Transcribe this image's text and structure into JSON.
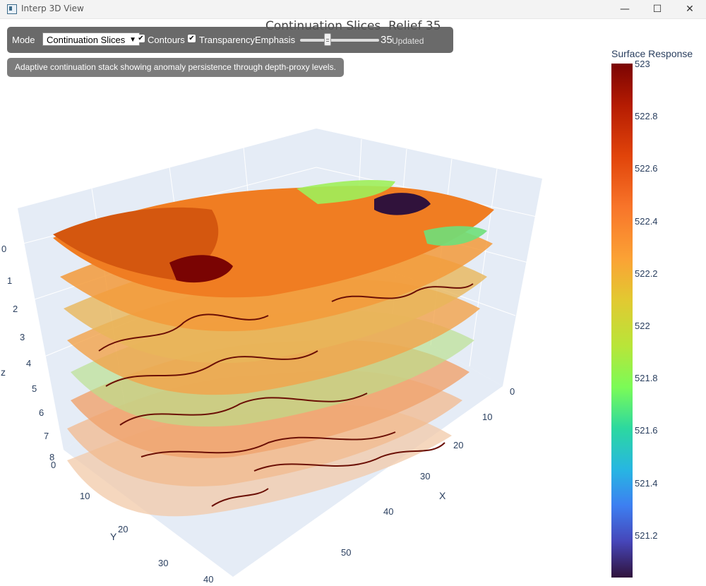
{
  "window": {
    "title": "Interp 3D View",
    "minimize_glyph": "—",
    "maximize_glyph": "☐",
    "close_glyph": "✕"
  },
  "plot": {
    "title": "Continuation Slices  Relief 35"
  },
  "toolbar": {
    "mode_label": "Mode",
    "mode_value": "Continuation Slices",
    "contours_label": "Contours",
    "contours_checked": true,
    "transparency_label": "TransparencyEmphasis",
    "transparency_checked": true,
    "relief_value": 35,
    "relief_display": "35",
    "relief_fraction": 0.35,
    "status": "Updated"
  },
  "description": "Adaptive continuation stack showing anomaly persistence through depth-proxy levels.",
  "colorbar": {
    "title": "Surface Response",
    "ticks": [
      "523",
      "522.8",
      "522.6",
      "522.4",
      "522.2",
      "522",
      "521.8",
      "521.6",
      "521.4",
      "521.2"
    ]
  },
  "scene": {
    "z_axis": {
      "label": "z",
      "ticks": [
        "0",
        "1",
        "2",
        "3",
        "4",
        "5",
        "6",
        "7",
        "8"
      ]
    },
    "y_axis": {
      "label": "Y",
      "ticks": [
        "0",
        "10",
        "20",
        "30",
        "40"
      ]
    },
    "x_axis": {
      "label": "X",
      "ticks": [
        "0",
        "10",
        "20",
        "30",
        "40",
        "50"
      ]
    }
  },
  "colors": {
    "slice_hot": "#e06a1c",
    "slice_warm": "#f7a63a",
    "slice_cool": "#8de86a",
    "contour": "#6b0f05",
    "grid": "#e5ecf6"
  }
}
